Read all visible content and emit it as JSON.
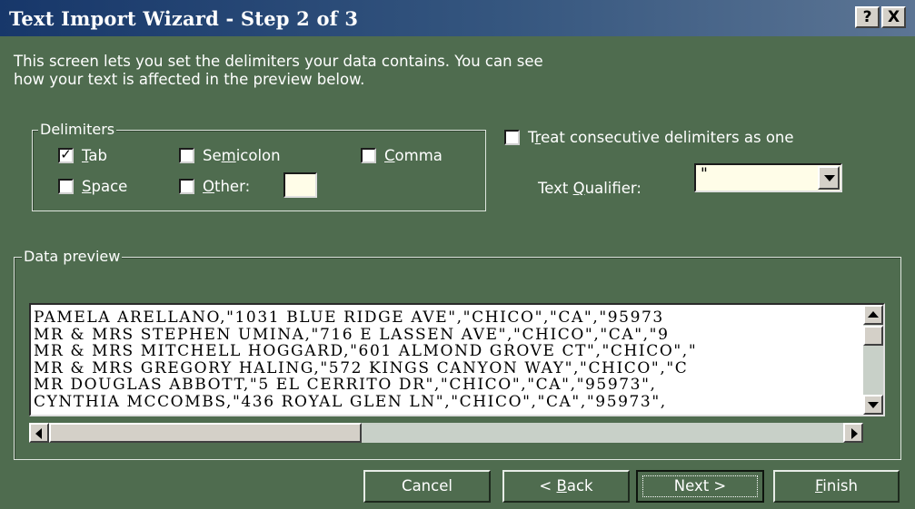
{
  "window": {
    "title": "Text Import Wizard - Step 2 of 3",
    "help_label": "?",
    "close_label": "X"
  },
  "description": {
    "line1": "This screen lets you set the delimiters your data contains.  You can see",
    "line2": "how your text is affected in the preview below."
  },
  "delimiters": {
    "group_label": "Delimiters",
    "tab": {
      "pre": "",
      "key": "T",
      "post": "ab",
      "checked": true
    },
    "semicolon": {
      "pre": "Se",
      "key": "m",
      "post": "icolon",
      "checked": false
    },
    "comma": {
      "pre": "",
      "key": "C",
      "post": "omma",
      "checked": false
    },
    "space": {
      "pre": "",
      "key": "S",
      "post": "pace",
      "checked": false
    },
    "other": {
      "pre": "",
      "key": "O",
      "post": "ther:",
      "checked": false,
      "value": ""
    }
  },
  "options": {
    "treat_consecutive": {
      "pre": "T",
      "key": "r",
      "post": "eat consecutive delimiters as one",
      "checked": false
    },
    "text_qualifier": {
      "pre": "Text ",
      "key": "Q",
      "post": "ualifier:",
      "value": "\""
    }
  },
  "preview": {
    "group_label": "Data preview",
    "lines": [
      "PAMELA ARELLANO,\"1031 BLUE RIDGE AVE\",\"CHICO\",\"CA\",\"95973",
      "MR & MRS STEPHEN UMINA,\"716 E LASSEN AVE\",\"CHICO\",\"CA\",\"9",
      "MR & MRS MITCHELL HOGGARD,\"601 ALMOND GROVE CT\",\"CHICO\",\"",
      "MR & MRS GREGORY HALING,\"572 KINGS CANYON WAY\",\"CHICO\",\"C",
      "MR DOUGLAS ABBOTT,\"5 EL CERRITO DR\",\"CHICO\",\"CA\",\"95973\",",
      "CYNTHIA MCCOMBS,\"436 ROYAL GLEN LN\",\"CHICO\",\"CA\",\"95973\","
    ]
  },
  "buttons": {
    "cancel": "Cancel",
    "back": {
      "pre": "< ",
      "key": "B",
      "post": "ack"
    },
    "next": "Next >",
    "finish": {
      "pre": "",
      "key": "F",
      "post": "inish"
    }
  },
  "colors": {
    "dialog_bg": "#4f6c4f",
    "title_bar": "#17376a",
    "preview_bg": "#ffffff",
    "field_bg": "#fffde8"
  }
}
